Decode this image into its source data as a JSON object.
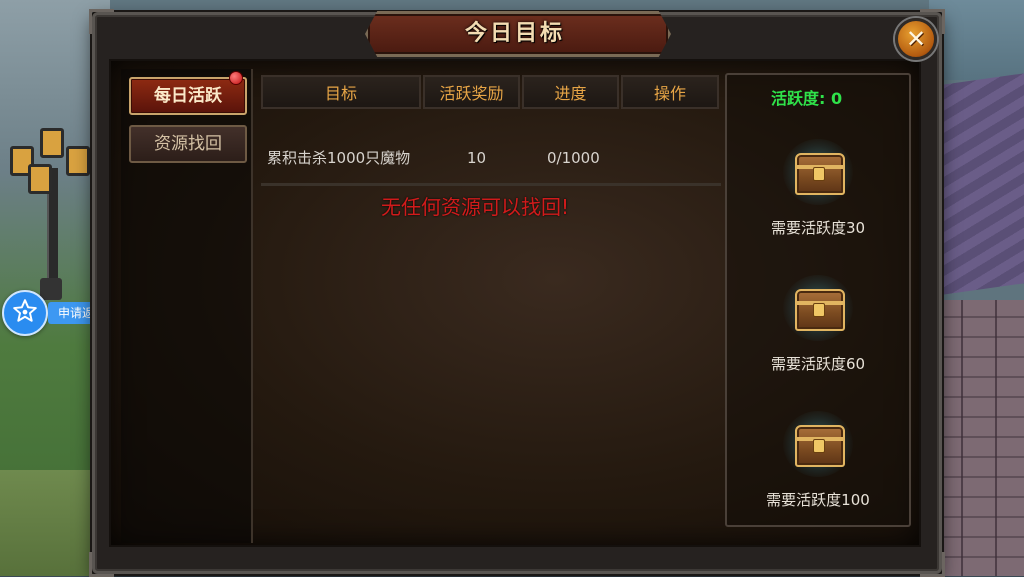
{
  "window": {
    "title": "今日目标"
  },
  "close_label": "✕",
  "floating": {
    "rebate_label": "申请返利",
    "icon": "star-icon"
  },
  "tabs": [
    {
      "label": "每日活跃",
      "active": true,
      "has_badge": true
    },
    {
      "label": "资源找回",
      "active": false
    }
  ],
  "table": {
    "headers": [
      "目标",
      "活跃奖励",
      "进度",
      "操作"
    ],
    "rows": [
      {
        "goal": "累积击杀1000只魔物",
        "reward": "10",
        "progress": "0/1000",
        "action": ""
      }
    ],
    "empty_message": "无任何资源可以找回!"
  },
  "activity": {
    "label": "活跃度: 0",
    "chests": [
      {
        "label": "需要活跃度30"
      },
      {
        "label": "需要活跃度60"
      },
      {
        "label": "需要活跃度100"
      }
    ]
  },
  "colors": {
    "activity_text": "#2fe24a",
    "header_text": "#e7a546",
    "empty_message": "#d11b1b",
    "badge": "#c01010"
  }
}
